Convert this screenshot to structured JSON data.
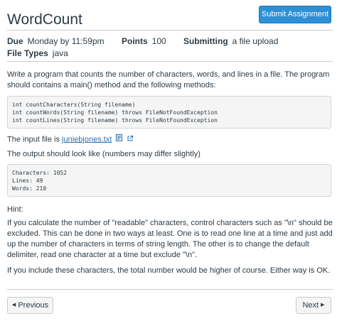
{
  "header": {
    "title": "WordCount",
    "submit_label": "Submit Assignment"
  },
  "details": {
    "due_label": "Due",
    "due_value": "Monday by 11:59pm",
    "points_label": "Points",
    "points_value": "100",
    "submitting_label": "Submitting",
    "submitting_value": "a file upload",
    "file_types_label": "File Types",
    "file_types_value": "java"
  },
  "content": {
    "intro": "Write a program that counts the number of characters, words, and lines in a file. The program should contains a main() method and the following methods:",
    "methods_code": [
      "int countCharacters(String filename)",
      "int countWords(String filename) throws FileNotFoundException",
      "int countLines(String filename) throws FileNotFoundException"
    ],
    "input_prefix": "The input file is ",
    "input_file": "juniebjones.txt",
    "output_intro": "The output should look like (numbers may differ slightly)",
    "output_code": [
      "Characters: 1052",
      "Lines: 49",
      "Words: 210"
    ],
    "hint_label": "Hint:",
    "hint_text": "If you calculate the number of \"readable\" characters, control characters such as \"\\n\" should be excluded. This can be done in two ways at least. One is to read one line at a time and just add up the number of characters in terms of string length. The other is to change the default delimiter, read one character at a time but exclude \"\\n\".",
    "closing": "If you include these characters, the total number would be higher of course. Either way is OK."
  },
  "nav": {
    "previous_label": "Previous",
    "next_label": "Next"
  },
  "icons": {
    "preview": "document-preview-icon",
    "external": "external-link-icon",
    "prev_arrow": "triangle-left-icon",
    "next_arrow": "triangle-right-icon"
  },
  "colors": {
    "accent": "#2d8fd5",
    "link": "#2d73b0",
    "text": "#2d3b45"
  }
}
